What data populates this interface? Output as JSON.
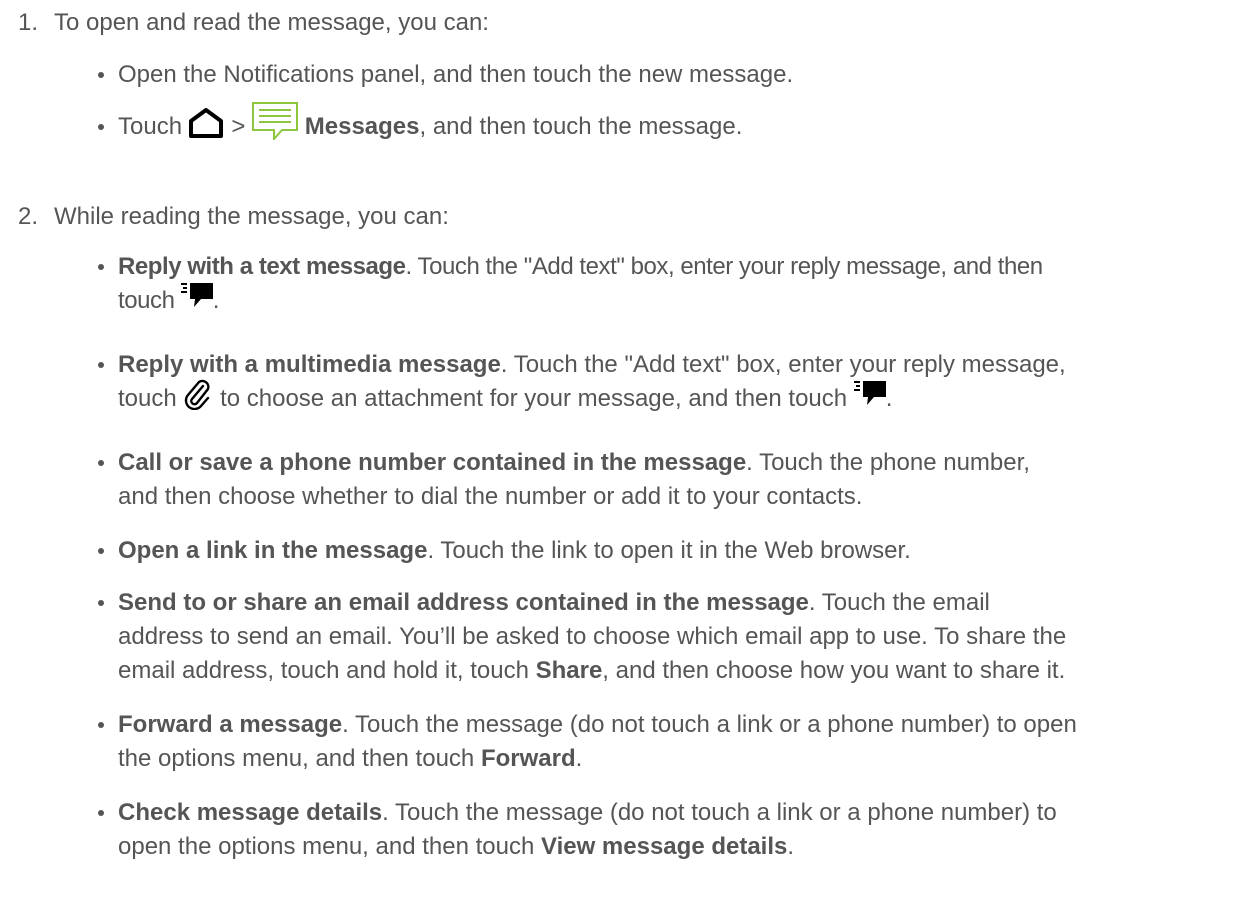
{
  "steps": [
    {
      "number": "1.",
      "text": "To open and read the message, you can:",
      "bullets": [
        {
          "text": "Open the Notifications panel, and then touch the new message."
        },
        {
          "before": "Touch",
          "icon1": "home-icon",
          "sep": ">",
          "icon2": "messages-app-icon",
          "bold": "Messages",
          "after": ", and then touch the message."
        }
      ]
    },
    {
      "number": "2.",
      "text": "While reading the message, you can:",
      "bullets": [
        {
          "bold": "Reply with a text message",
          "line1": ". Touch the \"Add text\" box, enter your reply message, and then",
          "line2": "touch",
          "icon": "send-icon",
          "end": "."
        },
        {
          "bold": "Reply with a multimedia message",
          "line1": ". Touch the \"Add text\" box, enter your reply message,",
          "line2a": "touch",
          "icon_a": "paperclip-icon",
          "line2b": "to choose an attachment for your message, and then touch",
          "icon_b": "send-icon",
          "end": "."
        },
        {
          "bold": "Call or save a phone number contained in the message",
          "line1": ". Touch the phone number,",
          "line2": "and then choose whether to dial the number or add it to your contacts."
        },
        {
          "bold": "Open a link in the message",
          "rest": ". Touch the link to open it in the Web browser."
        },
        {
          "bold": "Send to or share an email address contained in the message",
          "line1": ". Touch the email",
          "line2": "address to send an email. You’ll be asked to choose which email app to use. To share the",
          "line3a": "email address, touch and hold it, touch",
          "bold2": "Share",
          "line3b": ", and then choose how you want to share it."
        },
        {
          "bold": "Forward a message",
          "line1": ". Touch the message (do not touch a link or a phone number) to open",
          "line2a": "the options menu, and then touch",
          "bold2": "Forward",
          "end": "."
        },
        {
          "bold": "Check message details",
          "line1": ". Touch the message (do not touch a link or a phone number) to",
          "line2a": "open the options menu, and then touch",
          "bold2": "View message details",
          "end": "."
        }
      ]
    }
  ],
  "colors": {
    "text": "#555555",
    "messages_icon_green": "#8cc63f",
    "icon_dark": "#000000"
  }
}
